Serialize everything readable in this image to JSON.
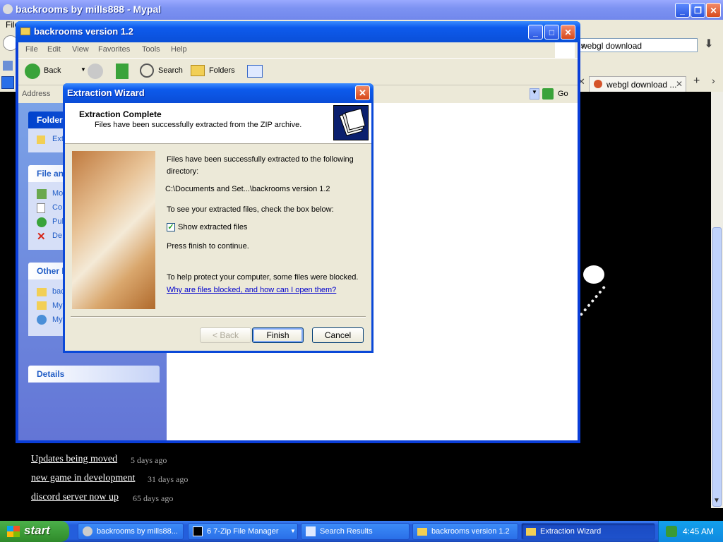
{
  "browser": {
    "title": "backrooms by mills888 - Mypal",
    "menu_first": "File",
    "search_value": "webgl download",
    "tab_label": "webgl download ...",
    "news": [
      {
        "title": "Updates being moved",
        "age": "5 days ago"
      },
      {
        "title": "new game in development",
        "age": "31 days ago"
      },
      {
        "title": "discord server now up",
        "age": "65 days ago"
      }
    ]
  },
  "explorer": {
    "title": "backrooms version 1.2",
    "menu": [
      "File",
      "Edit",
      "View",
      "Favorites",
      "Tools",
      "Help"
    ],
    "toolbar": {
      "back": "Back",
      "search": "Search",
      "folders": "Folders"
    },
    "address_label": "Address",
    "go_label": "Go",
    "taskpane": {
      "folder_tasks": {
        "title": "Folder",
        "items": [
          "Ext"
        ]
      },
      "file_tasks": {
        "title": "File an",
        "items": [
          "Mo",
          "Co",
          "Pul",
          "De"
        ]
      },
      "other_places": {
        "title": "Other P",
        "items": [
          "bac",
          "My",
          "My"
        ]
      },
      "details": {
        "title": "Details"
      }
    }
  },
  "wizard": {
    "title": "Extraction Wizard",
    "header_title": "Extraction Complete",
    "header_subtitle": "Files have been successfully extracted from the ZIP archive.",
    "line1": "Files have been successfully extracted to the following",
    "line1b": "directory:",
    "path": "C:\\Documents and Set...\\backrooms version 1.2",
    "line2": "To see your extracted files, check the box below:",
    "checkbox_label": "Show extracted files",
    "checkbox_checked": true,
    "line3": "Press finish to continue.",
    "line4": "To help protect your computer, some files were blocked.",
    "link": "Why are files blocked, and how can I open them?",
    "buttons": {
      "back": "< Back",
      "finish": "Finish",
      "cancel": "Cancel"
    }
  },
  "taskbar": {
    "start": "start",
    "buttons": [
      {
        "label": "backrooms by mills88...",
        "active": false
      },
      {
        "label": "6 7-Zip File Manager",
        "active": false
      },
      {
        "label": "Search Results",
        "active": false
      },
      {
        "label": "backrooms version 1.2",
        "active": false
      },
      {
        "label": "Extraction Wizard",
        "active": true
      }
    ],
    "clock": "4:45 AM"
  }
}
